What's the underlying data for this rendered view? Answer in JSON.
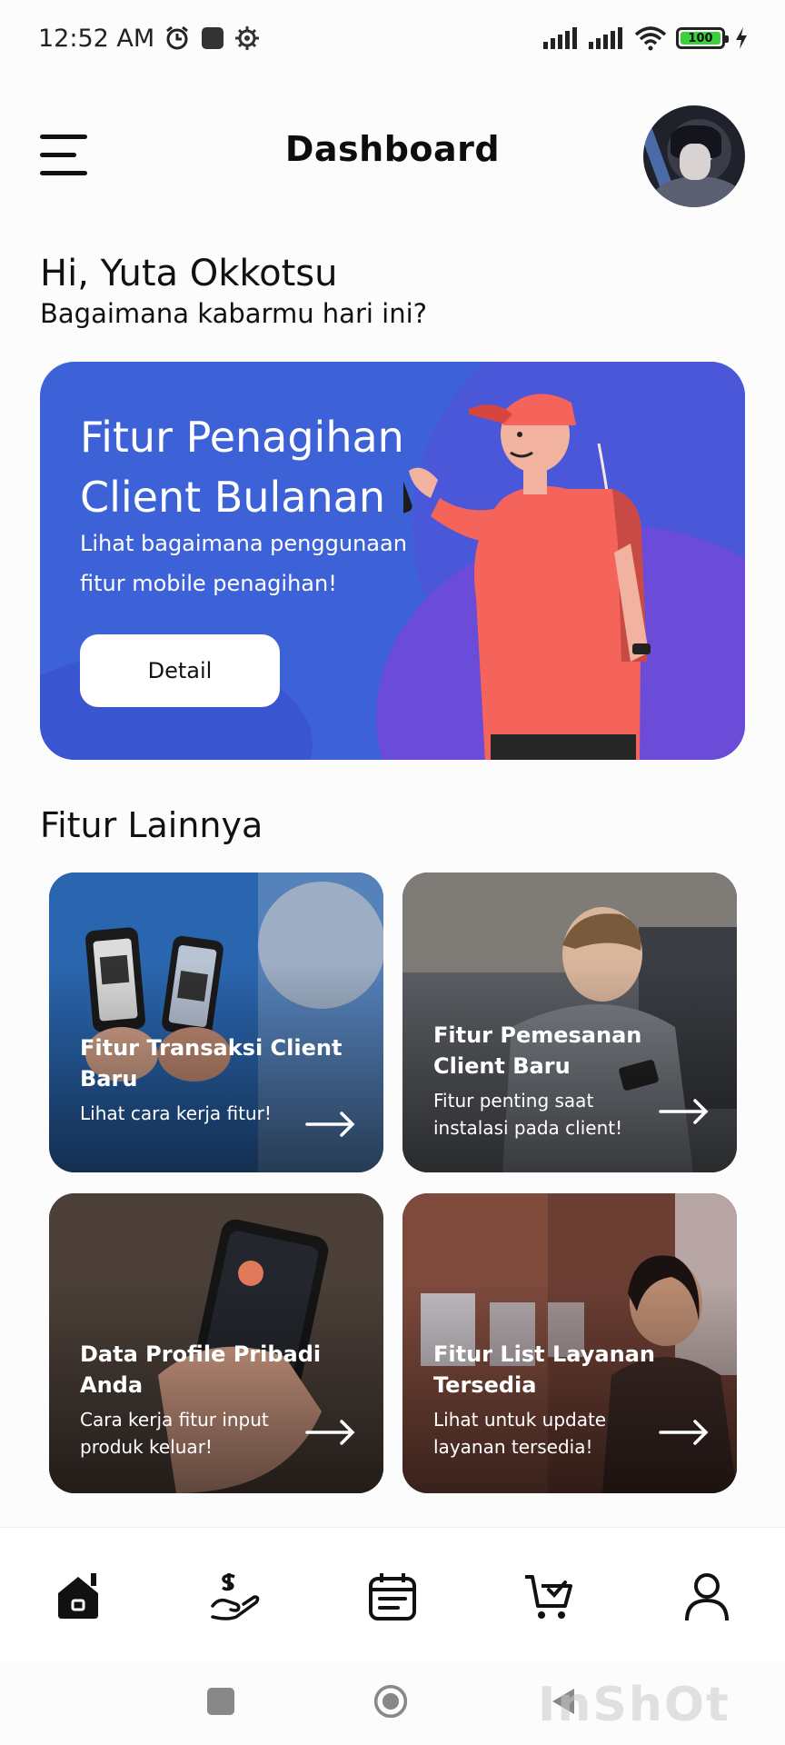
{
  "status_bar": {
    "time": "12:52 AM",
    "battery": "100",
    "icons": [
      "alarm-icon",
      "square-app-icon",
      "gear-icon",
      "signal-icon",
      "signal-icon-2",
      "wifi-icon",
      "battery-icon",
      "charging-icon"
    ]
  },
  "header": {
    "title": "Dashboard",
    "menu_icon": "hamburger-icon",
    "avatar": "user-avatar"
  },
  "greeting": {
    "name": "Hi, Yuta Okkotsu",
    "subtitle": "Bagaimana kabarmu hari ini?"
  },
  "promo": {
    "title_line1": "Fitur Penagihan",
    "title_line2": "Client Bulanan",
    "desc": "Lihat bagaimana penggunaan fitur mobile penagihan!",
    "button_label": "Detail",
    "colors": {
      "bg": "#3d62d8",
      "accent": "#6a4cd8",
      "figure_shirt": "#f4645a"
    }
  },
  "section": {
    "title": "Fitur Lainnya"
  },
  "feature_cards": [
    {
      "title": "Fitur Transaksi Client Baru",
      "desc": "Lihat cara kerja fitur!"
    },
    {
      "title": "Fitur Pemesanan Client Baru",
      "desc": "Fitur penting saat instalasi pada client!"
    },
    {
      "title": "Data Profile Pribadi Anda",
      "desc": "Cara kerja fitur input produk keluar!"
    },
    {
      "title": "Fitur List Layanan Tersedia",
      "desc": "Lihat untuk update layanan tersedia!"
    }
  ],
  "bottom_nav": [
    {
      "icon": "home-icon",
      "active": true
    },
    {
      "icon": "payment-icon",
      "active": false
    },
    {
      "icon": "calendar-icon",
      "active": false
    },
    {
      "icon": "cart-icon",
      "active": false
    },
    {
      "icon": "profile-icon",
      "active": false
    }
  ],
  "system_nav": {
    "buttons": [
      "recents-icon",
      "home-circle-icon",
      "back-icon"
    ],
    "watermark": "InShOt"
  }
}
